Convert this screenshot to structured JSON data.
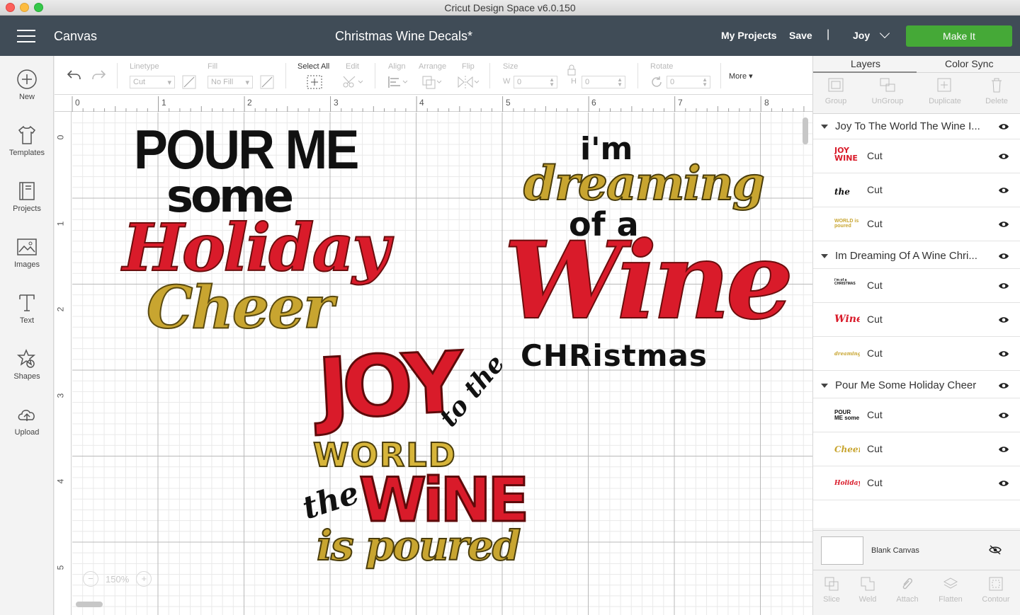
{
  "window": {
    "title": "Cricut Design Space  v6.0.150"
  },
  "header": {
    "canvas_label": "Canvas",
    "document_title": "Christmas Wine Decals*",
    "my_projects": "My Projects",
    "save": "Save",
    "separator": "|",
    "user": "Joy",
    "make_it": "Make It"
  },
  "sidebar": {
    "items": [
      {
        "label": "New",
        "icon": "plus-circle-icon"
      },
      {
        "label": "Templates",
        "icon": "tshirt-icon"
      },
      {
        "label": "Projects",
        "icon": "projects-icon"
      },
      {
        "label": "Images",
        "icon": "image-icon"
      },
      {
        "label": "Text",
        "icon": "text-icon"
      },
      {
        "label": "Shapes",
        "icon": "shapes-icon"
      },
      {
        "label": "Upload",
        "icon": "upload-cloud-icon"
      }
    ]
  },
  "toolbar": {
    "linetype_label": "Linetype",
    "linetype_value": "Cut",
    "fill_label": "Fill",
    "fill_value": "No Fill",
    "select_all": "Select All",
    "edit": "Edit",
    "align": "Align",
    "arrange": "Arrange",
    "flip": "Flip",
    "size": "Size",
    "w_label": "W",
    "w_value": "0",
    "h_label": "H",
    "h_value": "0",
    "rotate": "Rotate",
    "rotate_value": "0",
    "more": "More"
  },
  "canvas": {
    "ruler_top": [
      "0",
      "1",
      "2",
      "3",
      "4",
      "5",
      "6",
      "7",
      "8"
    ],
    "ruler_left": [
      "0",
      "1",
      "2",
      "3",
      "4",
      "5"
    ],
    "zoom": "150%",
    "designs": {
      "holiday": {
        "line1": "POUR ME",
        "line2": "some",
        "line3": "Holiday",
        "line4": "Cheer"
      },
      "dreaming": {
        "line1": "i'm",
        "line2": "dreaming",
        "line3": "of a",
        "line4": "Wine",
        "line5": "CHRistmas"
      },
      "joy": {
        "line1": "JOY",
        "line2": "to the",
        "line3": "WORLD",
        "line4": "the",
        "line5": "WiNE",
        "line6": "is poured"
      }
    }
  },
  "panel": {
    "tabs": [
      "Layers",
      "Color Sync"
    ],
    "actions": [
      "Group",
      "UnGroup",
      "Duplicate",
      "Delete"
    ],
    "groups": [
      {
        "name": "Joy To The World The Wine I...",
        "layers": [
          {
            "type": "Cut",
            "thumb": "JOY WINE",
            "color": "#d91b2a"
          },
          {
            "type": "Cut",
            "thumb": "the",
            "color": "#111111"
          },
          {
            "type": "Cut",
            "thumb": "WORLD is poured",
            "color": "#c8a530"
          }
        ]
      },
      {
        "name": "Im Dreaming Of A Wine Chri...",
        "layers": [
          {
            "type": "Cut",
            "thumb": "i'm of a CHRISTMAS",
            "color": "#111111"
          },
          {
            "type": "Cut",
            "thumb": "Wine",
            "color": "#d91b2a"
          },
          {
            "type": "Cut",
            "thumb": "dreaming",
            "color": "#c8a530"
          }
        ]
      },
      {
        "name": "Pour Me Some Holiday Cheer",
        "layers": [
          {
            "type": "Cut",
            "thumb": "POUR ME some",
            "color": "#111111"
          },
          {
            "type": "Cut",
            "thumb": "Cheer",
            "color": "#c8a530"
          },
          {
            "type": "Cut",
            "thumb": "Holiday",
            "color": "#d91b2a"
          }
        ]
      }
    ],
    "blank_canvas": "Blank Canvas",
    "bottom_actions": [
      "Slice",
      "Weld",
      "Attach",
      "Flatten",
      "Contour"
    ]
  },
  "colors": {
    "header_bg": "#404c57",
    "make_it": "#45a937",
    "red": "#d91b2a",
    "gold": "#c8a530",
    "black": "#111111"
  }
}
